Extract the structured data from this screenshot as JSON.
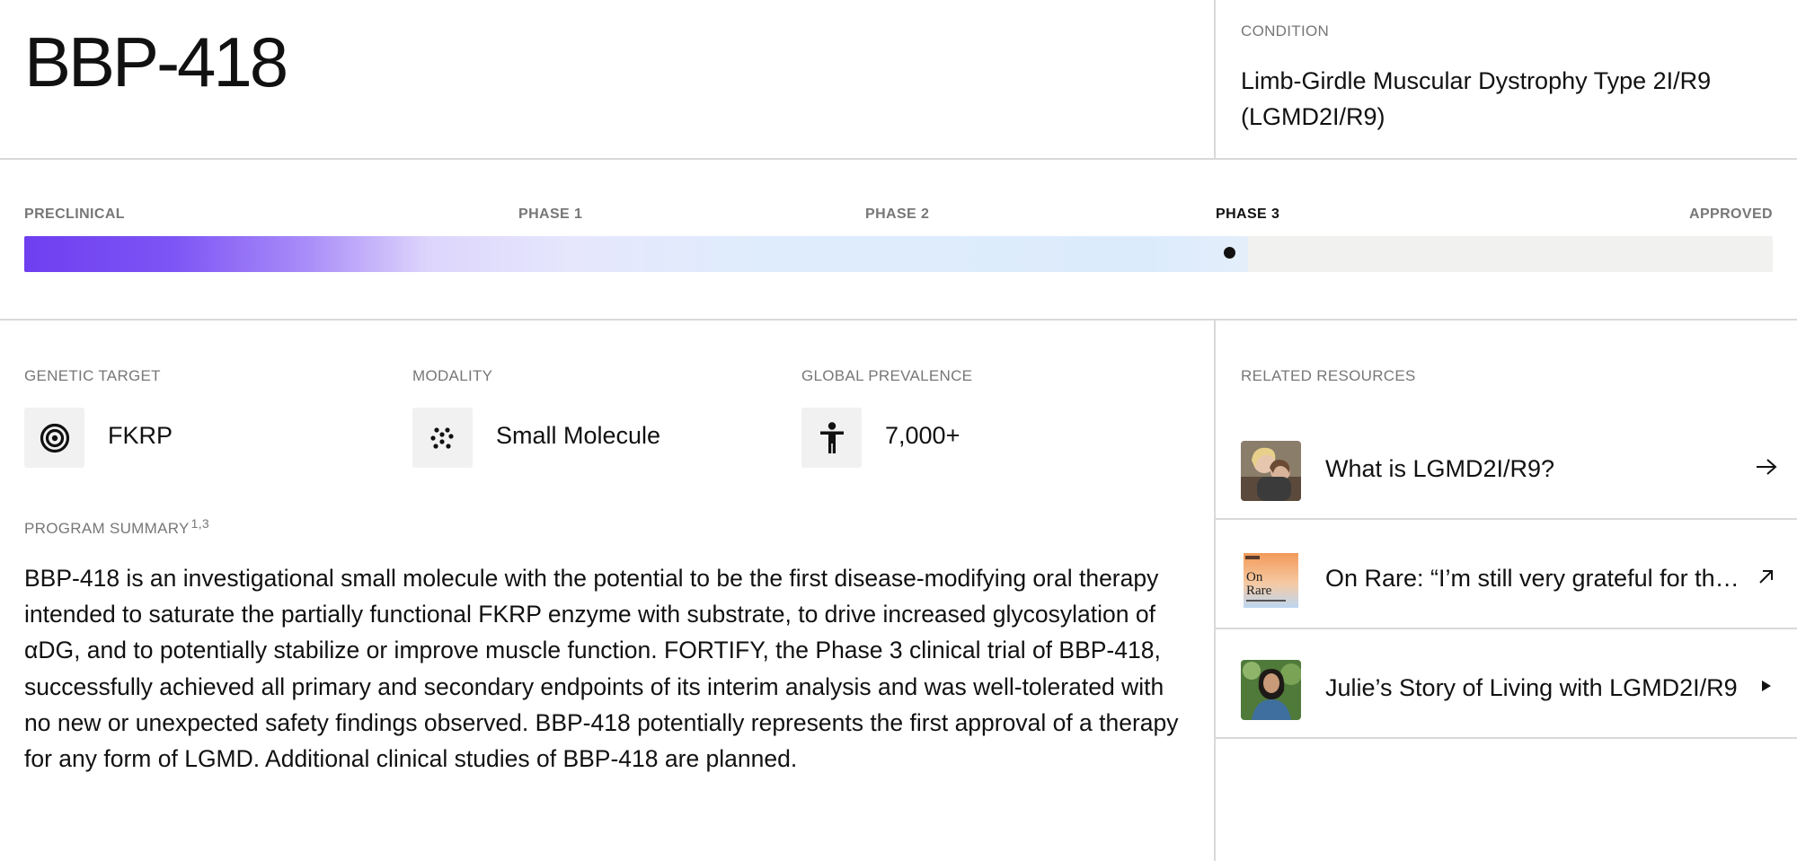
{
  "drug": {
    "name": "BBP-418"
  },
  "condition": {
    "label": "CONDITION",
    "value": "Limb-Girdle Muscular Dystrophy Type 2I/R9 (LGMD2I/R9)"
  },
  "pipeline": {
    "stages": [
      "PRECLINICAL",
      "PHASE 1",
      "PHASE 2",
      "PHASE 3",
      "APPROVED"
    ],
    "current_stage": "PHASE 3",
    "progress_percent": 70,
    "colors": {
      "start": "#6e3ff0",
      "mid": "#ddd5fc",
      "end": "#dcebfb",
      "track": "#f1f1ef"
    }
  },
  "stats": [
    {
      "label": "GENETIC TARGET",
      "value": "FKRP",
      "icon": "target-icon"
    },
    {
      "label": "MODALITY",
      "value": "Small Molecule",
      "icon": "molecule-icon"
    },
    {
      "label": "GLOBAL PREVALENCE",
      "value": "7,000+",
      "icon": "person-icon"
    }
  ],
  "summary": {
    "label": "PROGRAM SUMMARY",
    "footnotes": "1,3",
    "text": "BBP-418 is an investigational small molecule with the potential to be the first disease-modifying oral therapy intended to saturate the partially functional FKRP enzyme with substrate, to drive increased glycosylation of αDG, and to potentially stabilize or improve muscle function. FORTIFY, the Phase 3 clinical trial of BBP-418, successfully achieved all primary and secondary endpoints of its interim analysis and was well-tolerated with no new or unexpected safety findings observed. BBP-418 potentially represents the first approval of a therapy for any form of LGMD. Additional clinical studies of BBP-418 are planned."
  },
  "resources": {
    "label": "RELATED RESOURCES",
    "items": [
      {
        "title": "What is LGMD2I/R9?",
        "action_icon": "arrow-right-icon"
      },
      {
        "title": "On Rare: “I’m still very grateful for the…",
        "action_icon": "arrow-up-right-icon"
      },
      {
        "title": "Julie’s Story of Living with LGMD2I/R9",
        "action_icon": "play-icon"
      }
    ]
  }
}
